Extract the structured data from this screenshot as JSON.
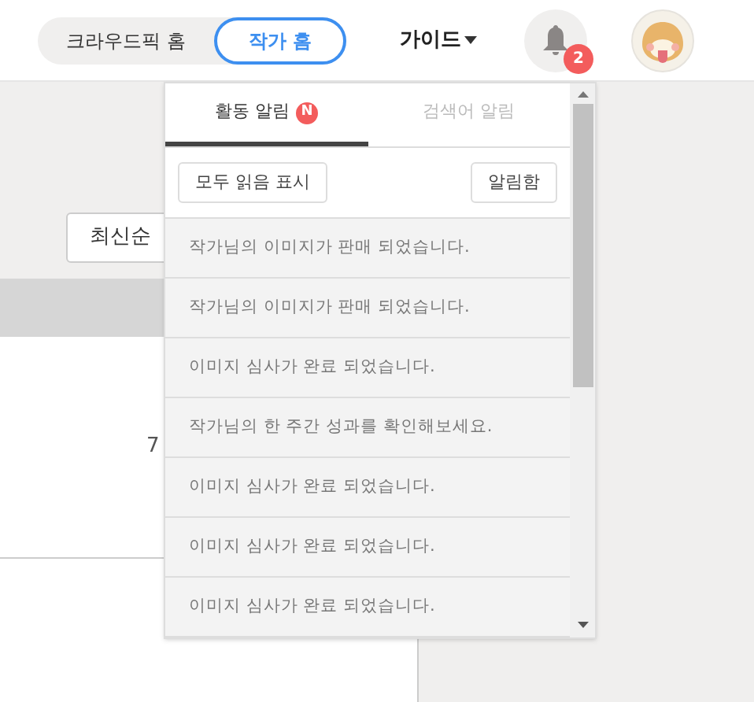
{
  "header": {
    "home_toggle": [
      {
        "label": "크라우드픽 홈",
        "selected": false
      },
      {
        "label": "작가 홈",
        "selected": true
      }
    ],
    "guide_menu": {
      "label": "가이드"
    },
    "notification_count": "2"
  },
  "page": {
    "sort_button": "최신순",
    "table": {
      "rows": [
        {
          "cells": [
            "7"
          ]
        }
      ]
    }
  },
  "notification_panel": {
    "tabs": [
      {
        "label": "활동 알림",
        "badge": "N",
        "selected": true
      },
      {
        "label": "검색어 알림",
        "selected": false
      }
    ],
    "actions": [
      "모두 읽음 표시",
      "알림함"
    ],
    "items": [
      "작가님의 이미지가 판매 되었습니다.",
      "작가님의 이미지가 판매 되었습니다.",
      "이미지 심사가 완료 되었습니다.",
      "작가님의 한 주간 성과를 확인해보세요.",
      "이미지 심사가 완료 되었습니다.",
      "이미지 심사가 완료 되었습니다.",
      "이미지 심사가 완료 되었습니다."
    ]
  }
}
